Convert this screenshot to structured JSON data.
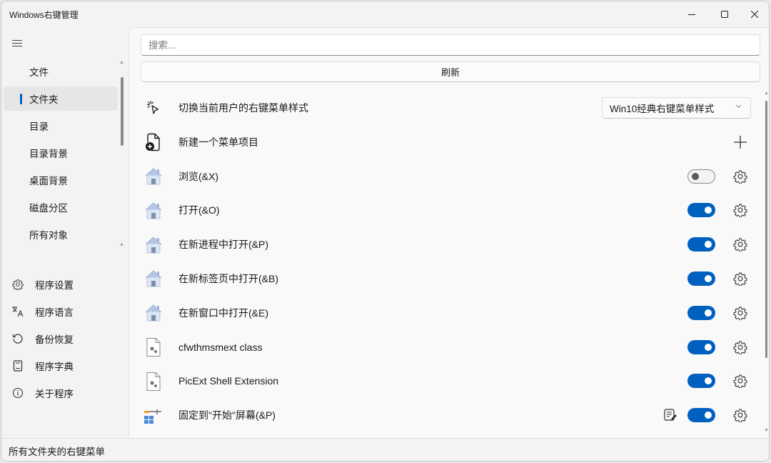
{
  "window": {
    "title": "Windows右键管理"
  },
  "sidebar": {
    "items": [
      {
        "label": "文件",
        "active": false
      },
      {
        "label": "文件夹",
        "active": true
      },
      {
        "label": "目录",
        "active": false
      },
      {
        "label": "目录背景",
        "active": false
      },
      {
        "label": "桌面背景",
        "active": false
      },
      {
        "label": "磁盘分区",
        "active": false
      },
      {
        "label": "所有对象",
        "active": false
      }
    ],
    "bottom_items": [
      {
        "label": "程序设置",
        "icon": "gear-icon"
      },
      {
        "label": "程序语言",
        "icon": "language-icon"
      },
      {
        "label": "备份恢复",
        "icon": "restore-icon"
      },
      {
        "label": "程序字典",
        "icon": "dictionary-icon"
      },
      {
        "label": "关于程序",
        "icon": "info-icon"
      }
    ]
  },
  "search": {
    "placeholder": "搜索...",
    "value": ""
  },
  "refresh_label": "刷新",
  "rows": {
    "style": {
      "label": "切换当前用户的右键菜单样式",
      "selected": "Win10经典右键菜单样式"
    },
    "new_item": {
      "label": "新建一个菜单项目"
    },
    "items": [
      {
        "label": "浏览(&X)",
        "enabled": false,
        "icon": "house-icon"
      },
      {
        "label": "打开(&O)",
        "enabled": true,
        "icon": "house-icon"
      },
      {
        "label": "在新进程中打开(&P)",
        "enabled": true,
        "icon": "house-icon"
      },
      {
        "label": "在新标签页中打开(&B)",
        "enabled": true,
        "icon": "house-icon"
      },
      {
        "label": "在新窗口中打开(&E)",
        "enabled": true,
        "icon": "house-icon"
      },
      {
        "label": "cfwthmsmext class",
        "enabled": true,
        "icon": "settings-file-icon"
      },
      {
        "label": "PicExt Shell Extension",
        "enabled": true,
        "icon": "settings-file-icon"
      },
      {
        "label": "固定到\"开始\"屏幕(&P)",
        "enabled": true,
        "icon": "pin-start-icon"
      }
    ]
  },
  "status": {
    "text": "所有文件夹的右键菜单"
  },
  "colors": {
    "accent": "#0060c0"
  }
}
